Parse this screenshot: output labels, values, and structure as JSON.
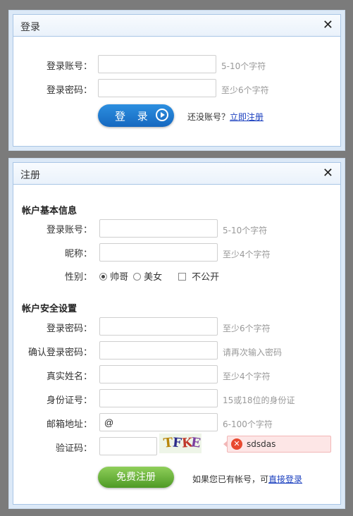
{
  "login": {
    "title": "登录",
    "close": "✕",
    "account_label": "登录账号：",
    "account_value": "",
    "account_hint": "5-10个字符",
    "password_label": "登录密码：",
    "password_value": "",
    "password_hint": "至少6个字符",
    "submit": "登 录",
    "no_account_text": "还没账号？",
    "register_link": "立即注册"
  },
  "register": {
    "title": "注册",
    "close": "✕",
    "basic_section": "帐户基本信息",
    "account_label": "登录账号：",
    "account_hint": "5-10个字符",
    "nickname_label": "昵称：",
    "nickname_hint": "至少4个字符",
    "gender_label": "性别：",
    "gender_options": [
      "帅哥",
      "美女",
      "不公开"
    ],
    "gender_selected": "帅哥",
    "security_section": "帐户安全设置",
    "password_label": "登录密码：",
    "password_hint": "至少6个字符",
    "confirm_label": "确认登录密码：",
    "confirm_hint": "请再次输入密码",
    "realname_label": "真实姓名：",
    "realname_hint": "至少4个字符",
    "idcard_label": "身份证号：",
    "idcard_hint": "15或18位的身份证",
    "email_label": "邮箱地址：",
    "email_value": "@",
    "email_hint": "6-100个字符",
    "captcha_label": "验证码：",
    "captcha_value": "",
    "captcha_chars": [
      "T",
      "F",
      "K",
      "E"
    ],
    "captcha_colors": [
      "#b8860b",
      "#2a2a8a",
      "#c0392b",
      "#7b3fa0"
    ],
    "error_text": "sdsdas",
    "submit": "免费注册",
    "has_account_text": "如果您已有帐号，可",
    "login_link": "直接登录"
  }
}
